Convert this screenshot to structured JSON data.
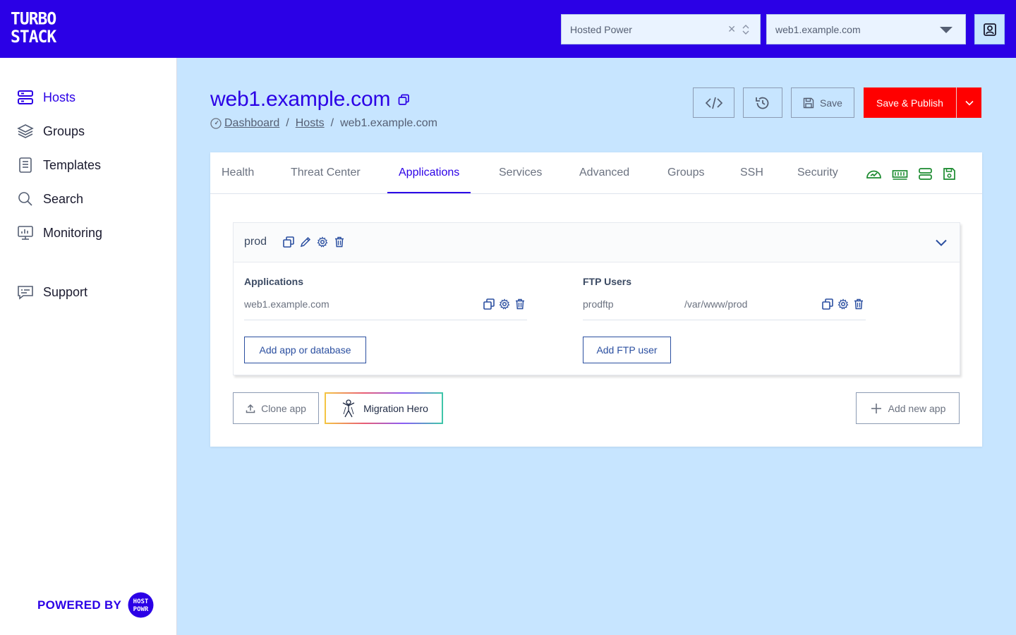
{
  "brand": {
    "logo_line1": "TURBO",
    "logo_line2": "STACK"
  },
  "header": {
    "org_select": {
      "value": "Hosted Power",
      "clear_icon": "close-icon"
    },
    "host_select": {
      "value": "web1.example.com"
    },
    "profile_icon": "user-profile-icon"
  },
  "sidebar": {
    "items": [
      {
        "label": "Hosts",
        "icon": "server-stack-icon",
        "active": true
      },
      {
        "label": "Groups",
        "icon": "layers-icon",
        "active": false
      },
      {
        "label": "Templates",
        "icon": "document-icon",
        "active": false
      },
      {
        "label": "Search",
        "icon": "search-icon",
        "active": false
      },
      {
        "label": "Monitoring",
        "icon": "monitor-icon",
        "active": false
      },
      {
        "label": "Support",
        "icon": "support-chat-icon",
        "active": false
      }
    ],
    "powered_by": "POWERED BY",
    "powered_logo_text": "HOSTED POWER"
  },
  "page": {
    "title": "web1.example.com",
    "breadcrumb": [
      "Dashboard",
      "Hosts",
      "web1.example.com"
    ],
    "toolbar": {
      "save_label": "Save",
      "publish_label": "Save & Publish"
    }
  },
  "tabs": [
    {
      "label": "Health",
      "active": false
    },
    {
      "label": "Threat Center",
      "active": false
    },
    {
      "label": "Applications",
      "active": true
    },
    {
      "label": "Services",
      "active": false
    },
    {
      "label": "Advanced",
      "active": false
    },
    {
      "label": "Groups",
      "active": false
    },
    {
      "label": "SSH",
      "active": false
    },
    {
      "label": "Security",
      "active": false
    }
  ],
  "tab_status_icons": [
    "dashboard-gauge-icon",
    "memory-icon",
    "server-icon",
    "floppy-save-icon"
  ],
  "status_color": "#1a8a2e",
  "environment": {
    "name": "prod",
    "applications": {
      "title": "Applications",
      "rows": [
        {
          "name": "web1.example.com"
        }
      ],
      "add_label": "Add app or database"
    },
    "ftp_users": {
      "title": "FTP Users",
      "rows": [
        {
          "user": "prodftp",
          "path": "/var/www/prod"
        }
      ],
      "add_label": "Add FTP user"
    }
  },
  "footer_actions": {
    "clone_label": "Clone app",
    "migration_label": "Migration Hero",
    "add_new_label": "Add new app"
  },
  "colors": {
    "brand": "#2b00e6",
    "danger": "#ff0000",
    "background": "#c7e5ff"
  }
}
